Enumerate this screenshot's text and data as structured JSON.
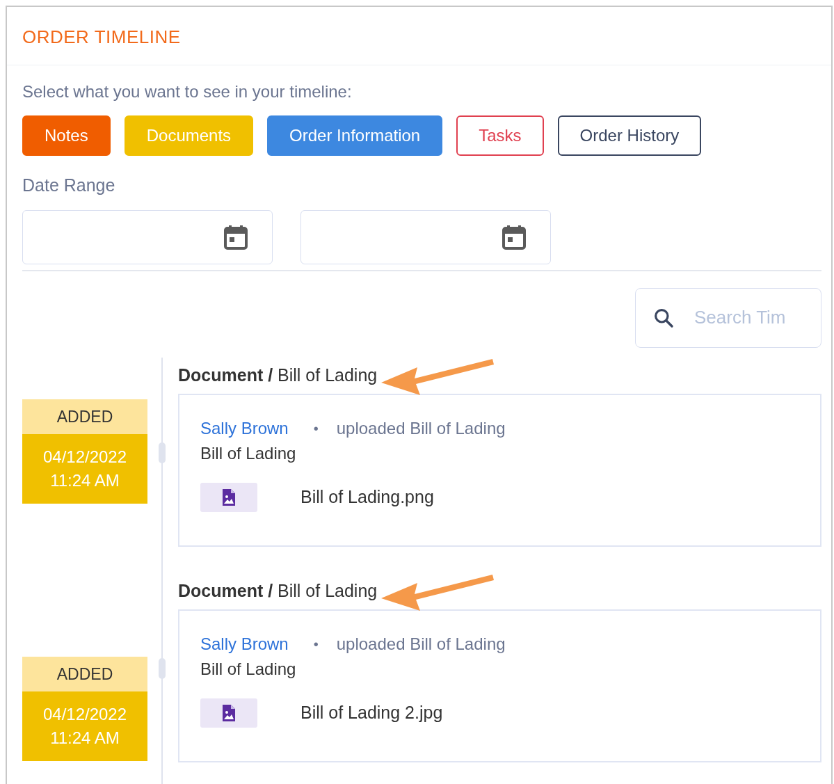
{
  "title": "ORDER TIMELINE",
  "prompt": "Select what you want to see in your timeline:",
  "filters": [
    {
      "label": "Notes",
      "selected": true,
      "color": "#f05d00"
    },
    {
      "label": "Documents",
      "selected": true,
      "color": "#f0c000"
    },
    {
      "label": "Order Information",
      "selected": true,
      "color": "#3d88e0"
    },
    {
      "label": "Tasks",
      "selected": false,
      "color": "#e04050"
    },
    {
      "label": "Order History",
      "selected": false,
      "color": "#3a4660"
    }
  ],
  "date_range": {
    "label": "Date Range"
  },
  "search": {
    "placeholder": "Search Tim"
  },
  "entries": [
    {
      "category": "Document /",
      "type": "Bill of Lading",
      "callout_arrow": true,
      "status": "ADDED",
      "date": "04/12/2022",
      "time": "11:24 AM",
      "user": "Sally Brown",
      "bullet": "•",
      "action": "uploaded Bill of Lading",
      "description": "Bill of Lading",
      "file": "Bill of Lading.png"
    },
    {
      "category": "Document /",
      "type": "Bill of Lading",
      "callout_arrow": true,
      "status": "ADDED",
      "date": "04/12/2022",
      "time": "11:24 AM",
      "user": "Sally Brown",
      "bullet": "•",
      "action": "uploaded Bill of Lading",
      "description": "Bill of Lading",
      "file": "Bill of Lading 2.jpg"
    }
  ]
}
